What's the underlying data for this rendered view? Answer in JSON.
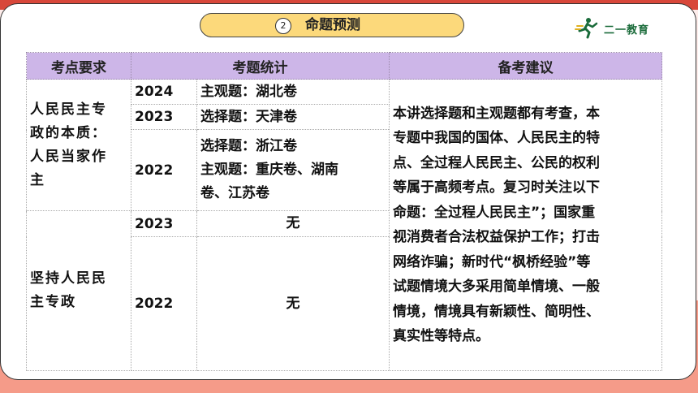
{
  "header": {
    "section_number": "2",
    "section_title": "命题预测",
    "logo_text": "二一教育"
  },
  "table": {
    "headers": [
      "考点要求",
      "考题统计",
      "备考建议"
    ],
    "topic1": [
      "人民民主专",
      "政的本质：",
      "人民当家作",
      "主"
    ],
    "topic2": [
      "坚持人民民",
      "主专政"
    ],
    "rows": [
      {
        "year": "2024",
        "exam": [
          "主观题：湖北卷"
        ]
      },
      {
        "year": "2023",
        "exam": [
          "选择题：天津卷"
        ]
      },
      {
        "year": "2022",
        "exam": [
          "选择题：浙江卷",
          "主观题：重庆卷、湖南",
          "卷、江苏卷"
        ]
      },
      {
        "year": "2023",
        "exam": [
          "无"
        ]
      },
      {
        "year": "2022",
        "exam": [
          "无"
        ]
      }
    ],
    "advice": [
      "本讲选择题和主观题都有考查，本",
      "专题中我国的国体、人民民主的特",
      "点、全过程人民民主、公民的权利",
      "等属于高频考点。复习时关注以下",
      "命题：全过程人民民主”；国家重",
      "视消费者合法权益保护工作；打击",
      "网络诈骗；新时代“枫桥经验”等",
      "试题情境大多采用简单情境、一般",
      "情境，情境具有新颖性、简明性、",
      "真实性等特点。"
    ]
  }
}
